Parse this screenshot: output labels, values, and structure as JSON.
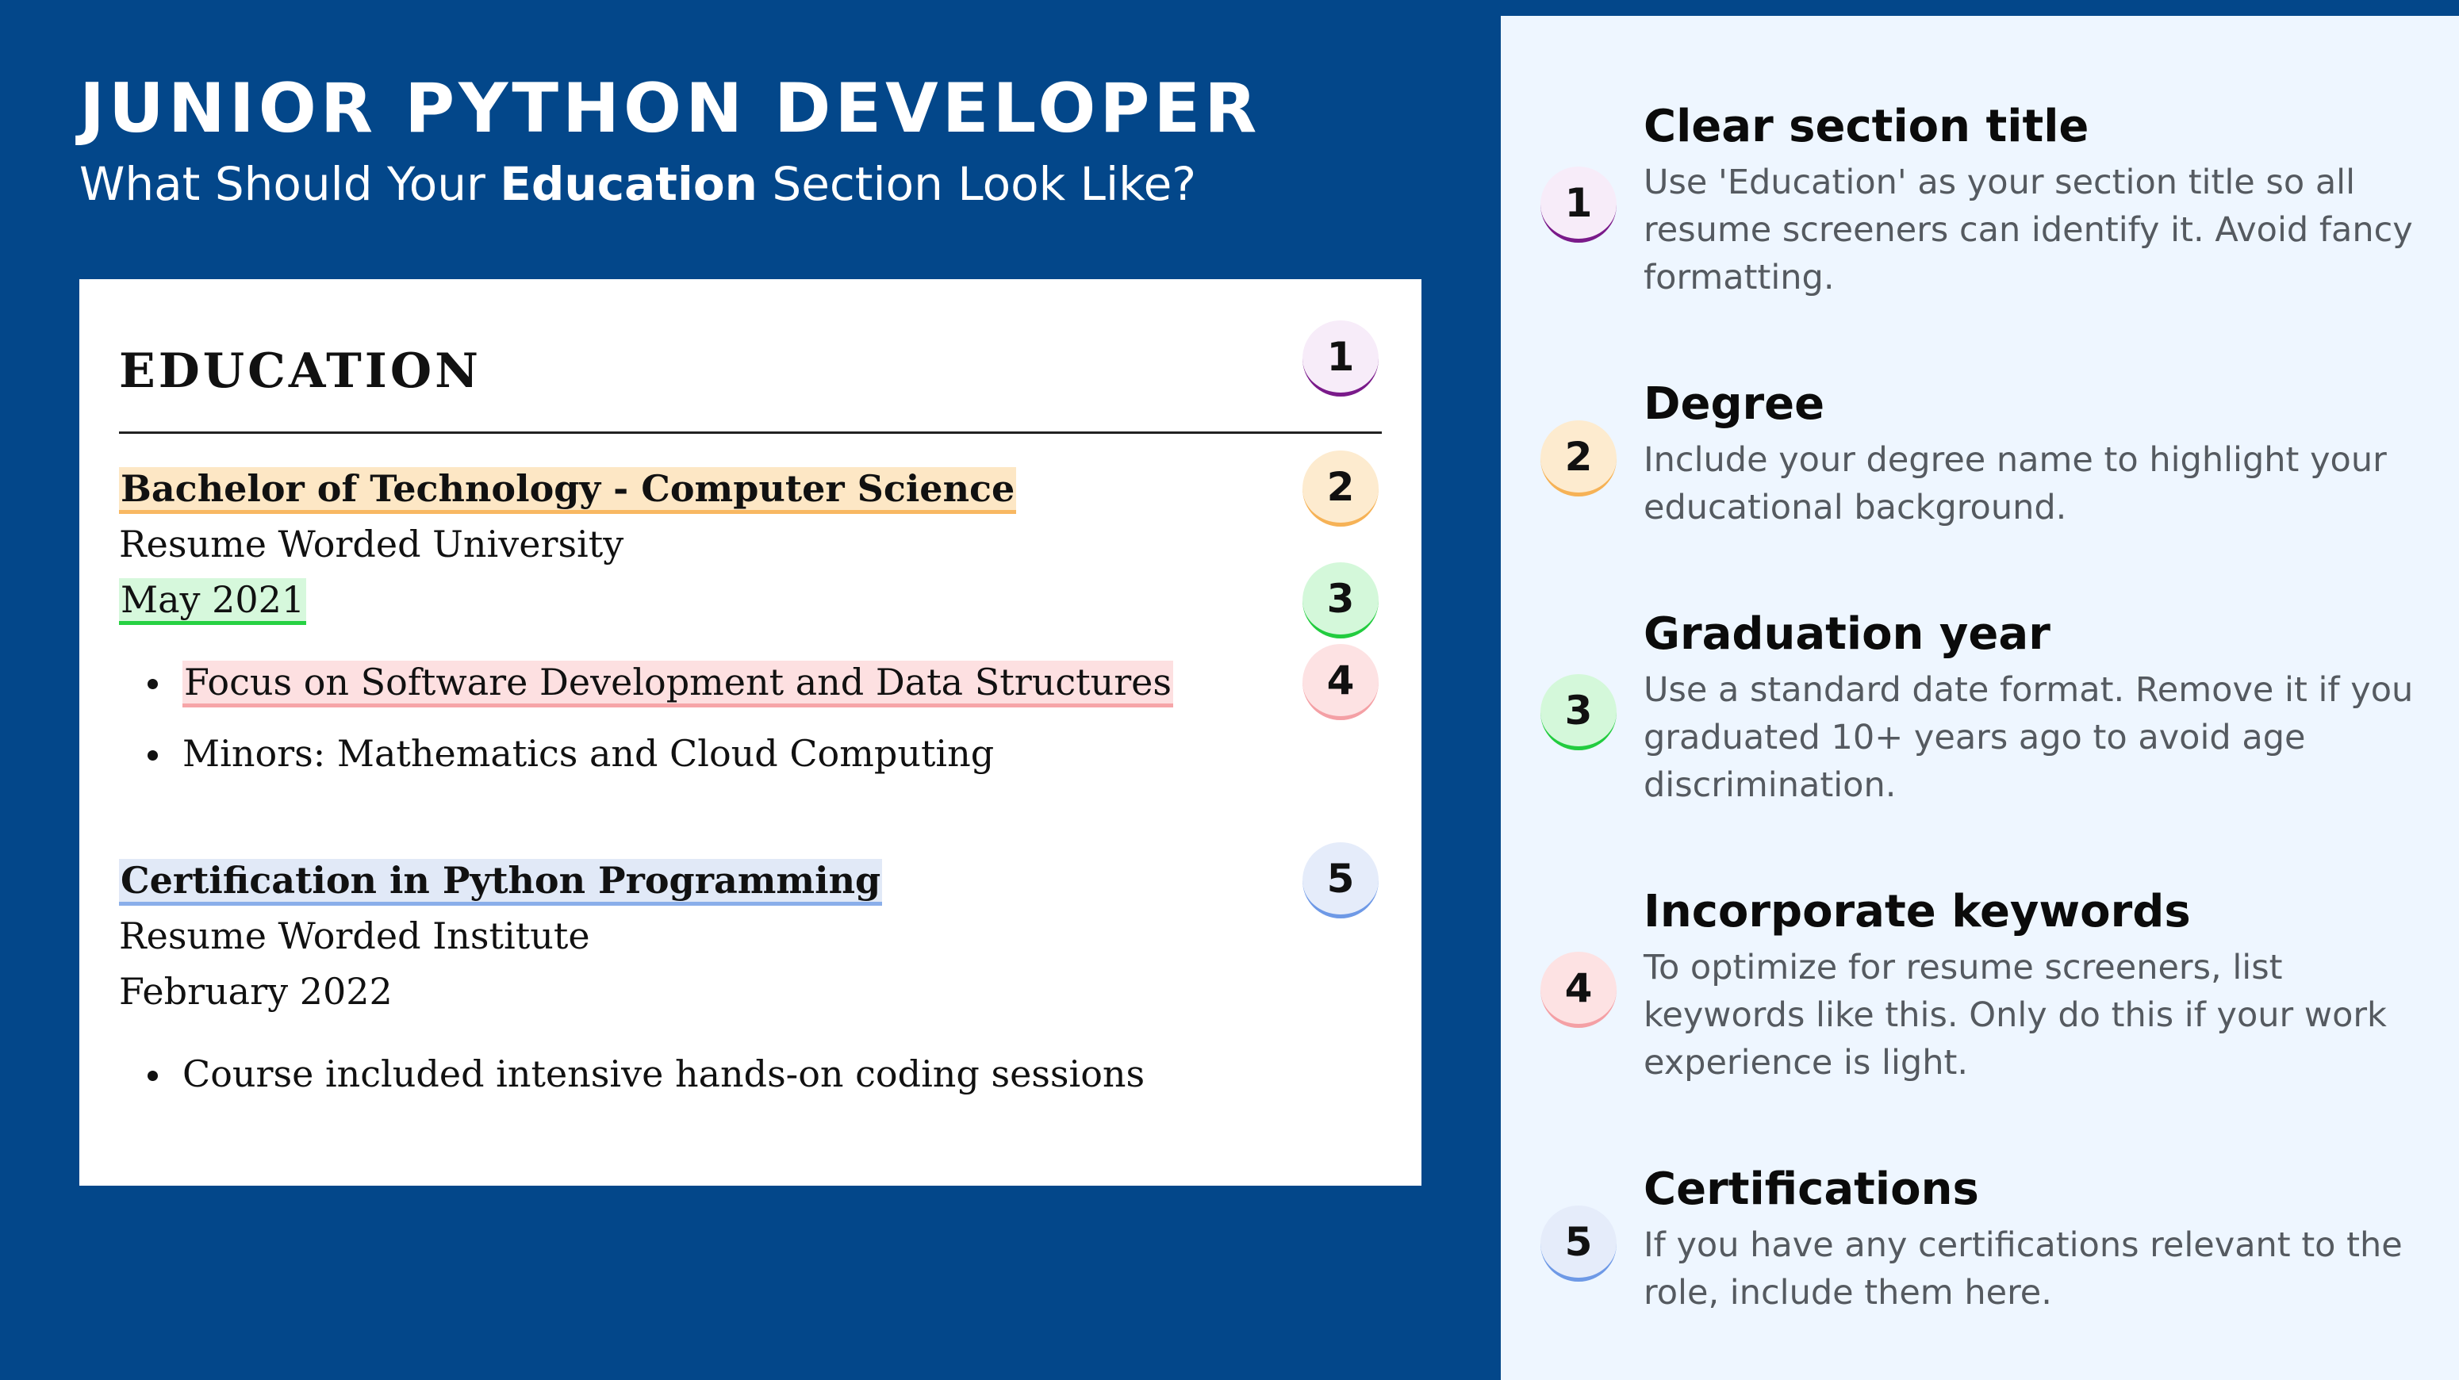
{
  "header": {
    "title": "JUNIOR PYTHON DEVELOPER",
    "subtitle_before": "What Should Your ",
    "subtitle_bold": "Education",
    "subtitle_after": " Section Look Like?"
  },
  "resume": {
    "section_heading": "EDUCATION",
    "entries": [
      {
        "title": "Bachelor of Technology - Computer Science",
        "institution": "Resume Worded University",
        "date": "May 2021",
        "bullets": [
          "Focus on Software Development and Data Structures",
          "Minors: Mathematics and Cloud Computing"
        ]
      },
      {
        "title": "Certification in Python Programming",
        "institution": "Resume Worded Institute",
        "date": "February 2022",
        "bullets": [
          "Course included intensive hands-on coding sessions"
        ]
      }
    ],
    "markers": [
      "1",
      "2",
      "3",
      "4",
      "5"
    ]
  },
  "tips": [
    {
      "number": "1",
      "title": "Clear section title",
      "body": "Use 'Education' as your section title so all resume screeners can identify it. Avoid fancy formatting."
    },
    {
      "number": "2",
      "title": "Degree",
      "body": "Include your degree name to highlight your educational background."
    },
    {
      "number": "3",
      "title": "Graduation year",
      "body": "Use a standard date format. Remove it if you graduated 10+ years ago to avoid age discrimination."
    },
    {
      "number": "4",
      "title": "Incorporate keywords",
      "body": "To optimize for resume screeners, list keywords like this. Only do this if your work experience is light."
    },
    {
      "number": "5",
      "title": "Certifications",
      "body": "If you have any certifications relevant to the role, include them here."
    }
  ],
  "colors": {
    "background": "#03478a",
    "panel": "#eef6ff",
    "marker_1": "#7a1a8a",
    "marker_2": "#f6b256",
    "marker_3": "#22cc3f",
    "marker_4": "#f4a0a5",
    "marker_5": "#6e99e6"
  }
}
